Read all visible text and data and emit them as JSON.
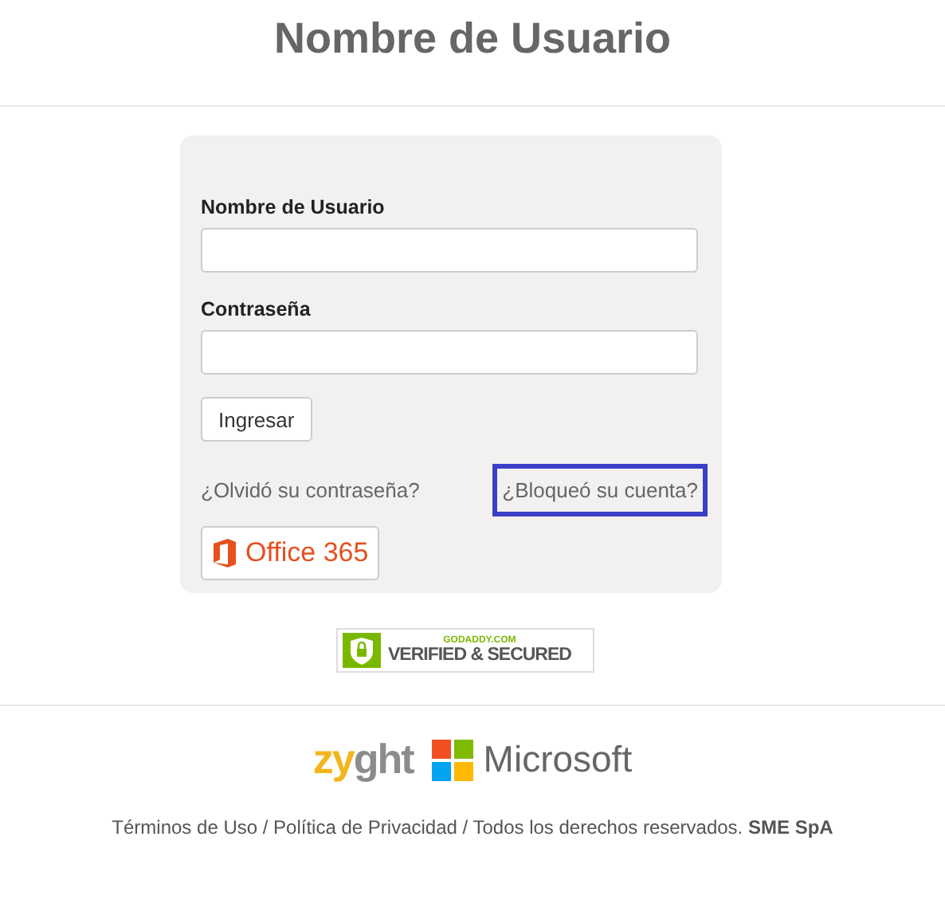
{
  "header": {
    "title": "Nombre de Usuario"
  },
  "form": {
    "fields": [
      {
        "label": "Nombre de Usuario"
      },
      {
        "label": "Contraseña"
      }
    ],
    "submit": "Ingresar",
    "links": [
      {
        "label": "¿Olvidó su contraseña?",
        "focused": false
      },
      {
        "label": "¿Bloqueó su cuenta?",
        "focused": true
      }
    ],
    "office_button": "Office 365"
  },
  "seal": {
    "top": "GODADDY.COM",
    "main": "VERIFIED & SECURED"
  },
  "logos": {
    "zyght": [
      {
        "text": "zy",
        "color": "#f3b51e"
      },
      {
        "text": "ght",
        "color": "#8c8c8c"
      }
    ],
    "microsoft": "Microsoft"
  },
  "footer": "Términos de Uso / Política de Privacidad / Todos los derechos reservados. **SME SpA**"
}
